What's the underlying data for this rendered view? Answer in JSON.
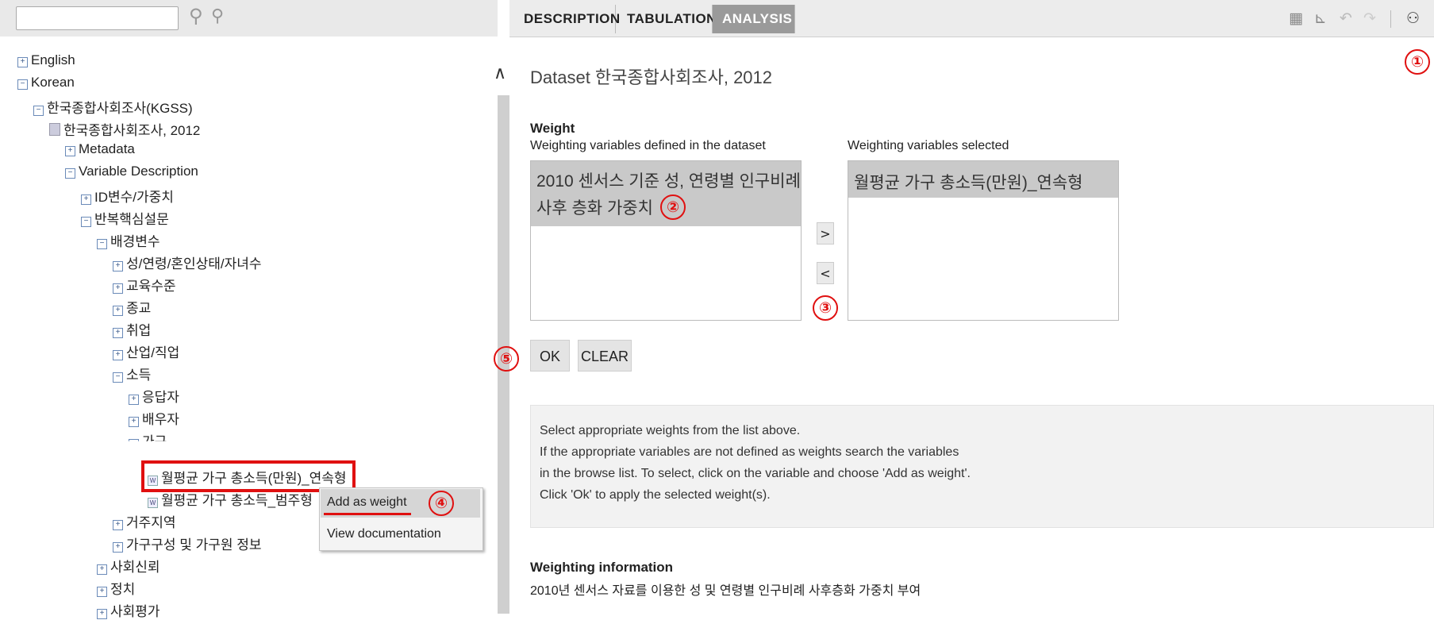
{
  "left_toolbar": {
    "search_placeholder": ""
  },
  "tabs": [
    {
      "label": "DESCRIPTION"
    },
    {
      "label": "TABULATION"
    },
    {
      "label": "ANALYSIS"
    }
  ],
  "tree": {
    "english": "English",
    "korean": "Korean",
    "kgss": "한국종합사회조사(KGSS)",
    "kgss2012": "한국종합사회조사, 2012",
    "metadata": "Metadata",
    "variable_description": "Variable Description",
    "id_weight": "ID변수/가중치",
    "core": "반복핵심설문",
    "background": "배경변수",
    "sex_age": "성/연령/혼인상태/자녀수",
    "education": "교육수준",
    "religion": "종교",
    "employment": "취업",
    "industry": "산업/직업",
    "income": "소득",
    "respondent": "응답자",
    "spouse": "배우자",
    "household": "가구",
    "var_continuous": "월평균 가구 총소득(만원)_연속형",
    "var_category": "월평균 가구 총소득_범주형",
    "residence": "거주지역",
    "household_info": "가구구성 및 가구원 정보",
    "social_trust": "사회신뢰",
    "politics": "정치",
    "next_partial": "사회평가"
  },
  "context_menu": {
    "add": "Add as weight",
    "view": "View documentation"
  },
  "analysis": {
    "dataset_title": "Dataset 한국종합사회조사, 2012",
    "weight_title": "Weight",
    "defined_label": "Weighting variables defined in the dataset",
    "selected_label": "Weighting variables selected",
    "defined_item_line1": "2010 센서스 기준 성, 연령별 인구비례",
    "defined_item_line2": "사후 층화 가중치",
    "selected_item": "월평균 가구 총소득(만원)_연속형",
    "move_right": ">",
    "move_left": "<",
    "ok": "OK",
    "clear": "CLEAR",
    "help_lines": [
      "Select appropriate weights from the list above.",
      "If the appropriate variables are not defined as weights search the variables",
      "in the browse list. To select, click on the variable and choose 'Add as weight'.",
      "Click 'Ok' to apply the selected weight(s)."
    ],
    "info_title": "Weighting information",
    "info_text": "2010년 센서스 자료를 이용한 성 및 연령별 인구비례 사후층화 가중치 부여"
  },
  "callouts": [
    "①",
    "②",
    "③",
    "④",
    "⑤"
  ],
  "colors": {
    "highlight": "#e01010",
    "active_tab": "#9a9a9a"
  }
}
